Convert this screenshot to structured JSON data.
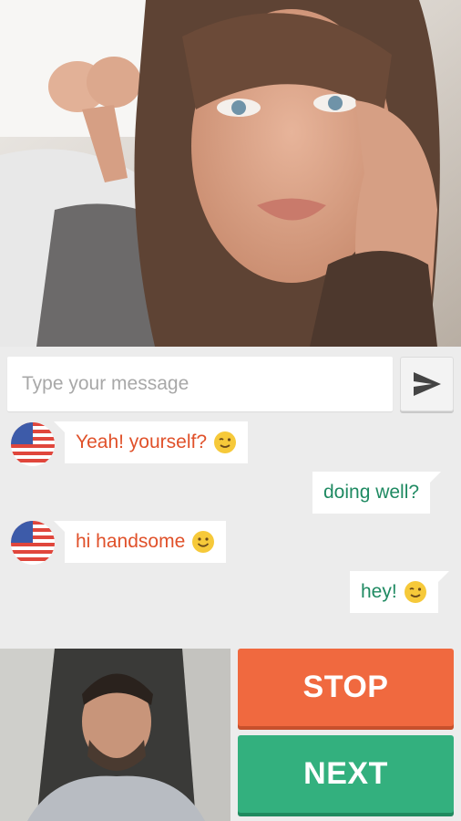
{
  "remote_video": {
    "label": ""
  },
  "composer": {
    "placeholder": "Type your message",
    "send_icon": "send-icon"
  },
  "messages": [
    {
      "direction": "in",
      "text": "Yeah! yourself?",
      "emoji": "winking-face",
      "flag": "us-flag-icon"
    },
    {
      "direction": "out",
      "text": "doing well?",
      "emoji": null
    },
    {
      "direction": "in",
      "text": "hi handsome",
      "emoji": "smiling-face",
      "flag": "us-flag-icon"
    },
    {
      "direction": "out",
      "text": "hey!",
      "emoji": "winking-face"
    }
  ],
  "actions": {
    "stop_label": "STOP",
    "next_label": "NEXT"
  },
  "colors": {
    "stop": "#f0693f",
    "next": "#33b07e",
    "incoming_text": "#e0512a",
    "outgoing_text": "#1f8a62"
  }
}
